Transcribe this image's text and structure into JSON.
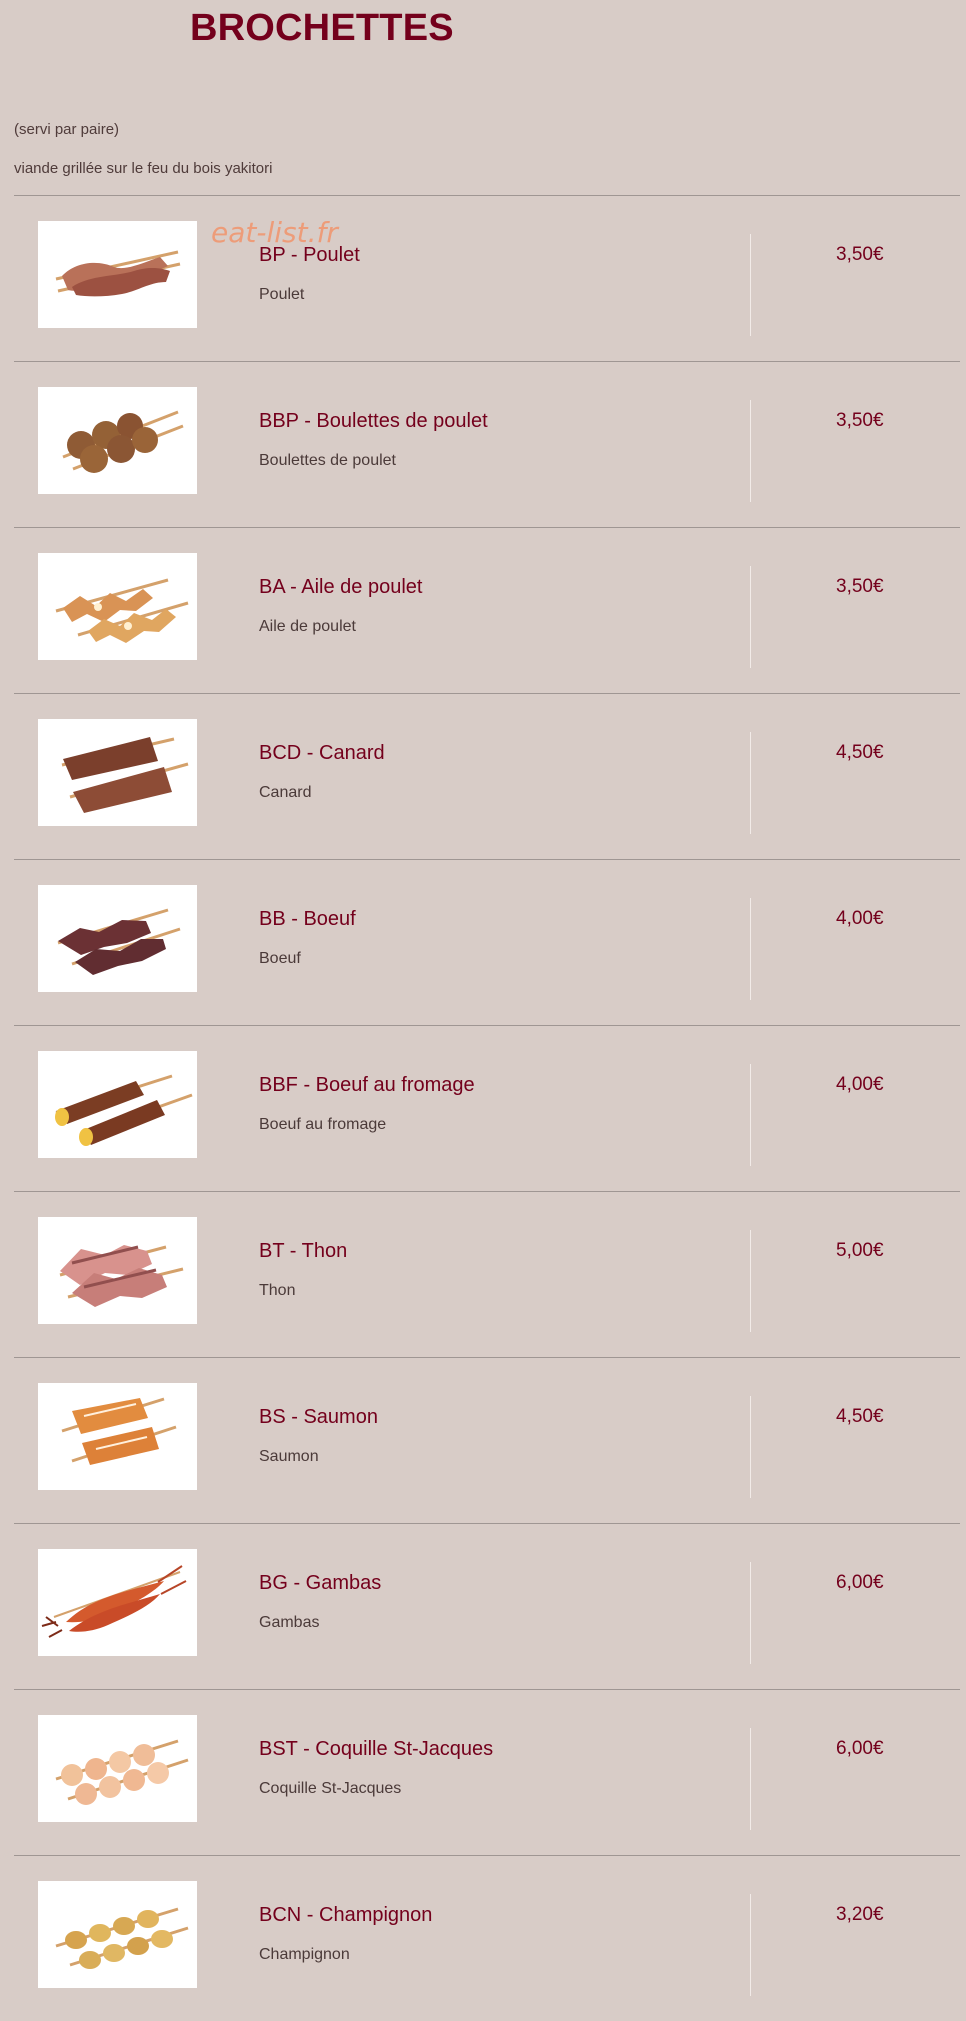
{
  "section": {
    "title": "BROCHETTES",
    "serving": "(servi par paire)",
    "description": "viande grillée sur le feu du bois yakitori",
    "watermark": "eat-list.fr"
  },
  "items": [
    {
      "name": "BP - Poulet",
      "description": "Poulet",
      "price": "3,50€",
      "image": "chicken-skewers-image"
    },
    {
      "name": "BBP - Boulettes de poulet",
      "description": "Boulettes de poulet",
      "price": "3,50€",
      "image": "chicken-meatball-skewers-image"
    },
    {
      "name": "BA - Aile de poulet",
      "description": "Aile de poulet",
      "price": "3,50€",
      "image": "chicken-wing-skewers-image"
    },
    {
      "name": "BCD - Canard",
      "description": "Canard",
      "price": "4,50€",
      "image": "duck-skewers-image"
    },
    {
      "name": "BB - Boeuf",
      "description": "Boeuf",
      "price": "4,00€",
      "image": "beef-skewers-image"
    },
    {
      "name": "BBF - Boeuf au fromage",
      "description": "Boeuf au fromage",
      "price": "4,00€",
      "image": "beef-cheese-skewers-image"
    },
    {
      "name": "BT - Thon",
      "description": "Thon",
      "price": "5,00€",
      "image": "tuna-skewers-image"
    },
    {
      "name": "BS - Saumon",
      "description": "Saumon",
      "price": "4,50€",
      "image": "salmon-skewers-image"
    },
    {
      "name": "BG - Gambas",
      "description": "Gambas",
      "price": "6,00€",
      "image": "shrimp-skewers-image"
    },
    {
      "name": "BST - Coquille St-Jacques",
      "description": "Coquille St-Jacques",
      "price": "6,00€",
      "image": "scallop-skewers-image"
    },
    {
      "name": "BCN - Champignon",
      "description": "Champignon",
      "price": "3,20€",
      "image": "mushroom-skewers-image"
    }
  ],
  "colors": {
    "background": "#d8ccc7",
    "accent": "#74001c",
    "divider": "#9f9693",
    "watermark": "#ef9a75"
  }
}
